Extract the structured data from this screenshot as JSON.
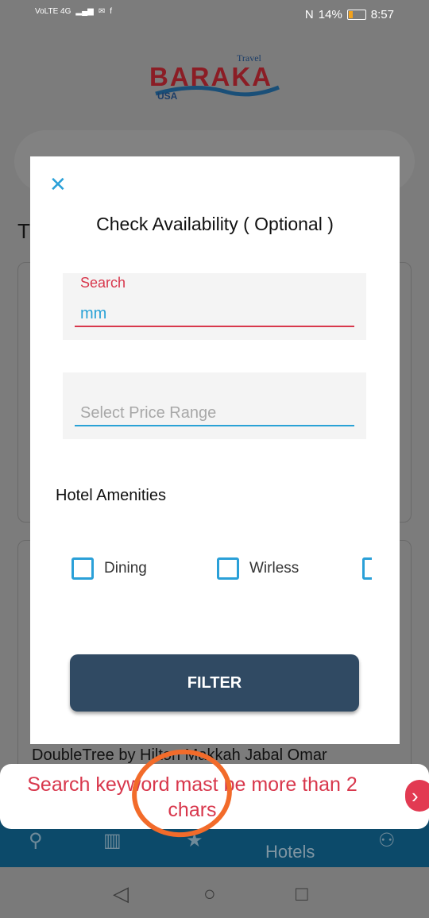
{
  "status_bar": {
    "left_text": "VoLTE 4G",
    "battery": "14%",
    "time": "8:57"
  },
  "logo": {
    "brand": "BARAKA",
    "travel": "Travel",
    "usa": "USA"
  },
  "background": {
    "section_letter": "T",
    "hotel_name": "DoubleTree by Hilton Makkah Jabal Omar",
    "nav_hotels_label": "Hotels"
  },
  "dialog": {
    "close_glyph": "✕",
    "title": "Check Availability ( Optional )",
    "search": {
      "label": "Search",
      "value": "mm"
    },
    "price": {
      "placeholder": "Select Price Range"
    },
    "amenities_heading": "Hotel Amenities",
    "amenities": [
      "Dining",
      "Wirless"
    ],
    "filter_button": "FILTER"
  },
  "toast": {
    "message": "Search keyword mast be more than 2 chars",
    "arrow_glyph": "›"
  },
  "colors": {
    "accent_blue": "#2aa0d8",
    "error_red": "#d8374c",
    "button_navy": "#304a63",
    "annotation_orange": "#f26b2a"
  }
}
